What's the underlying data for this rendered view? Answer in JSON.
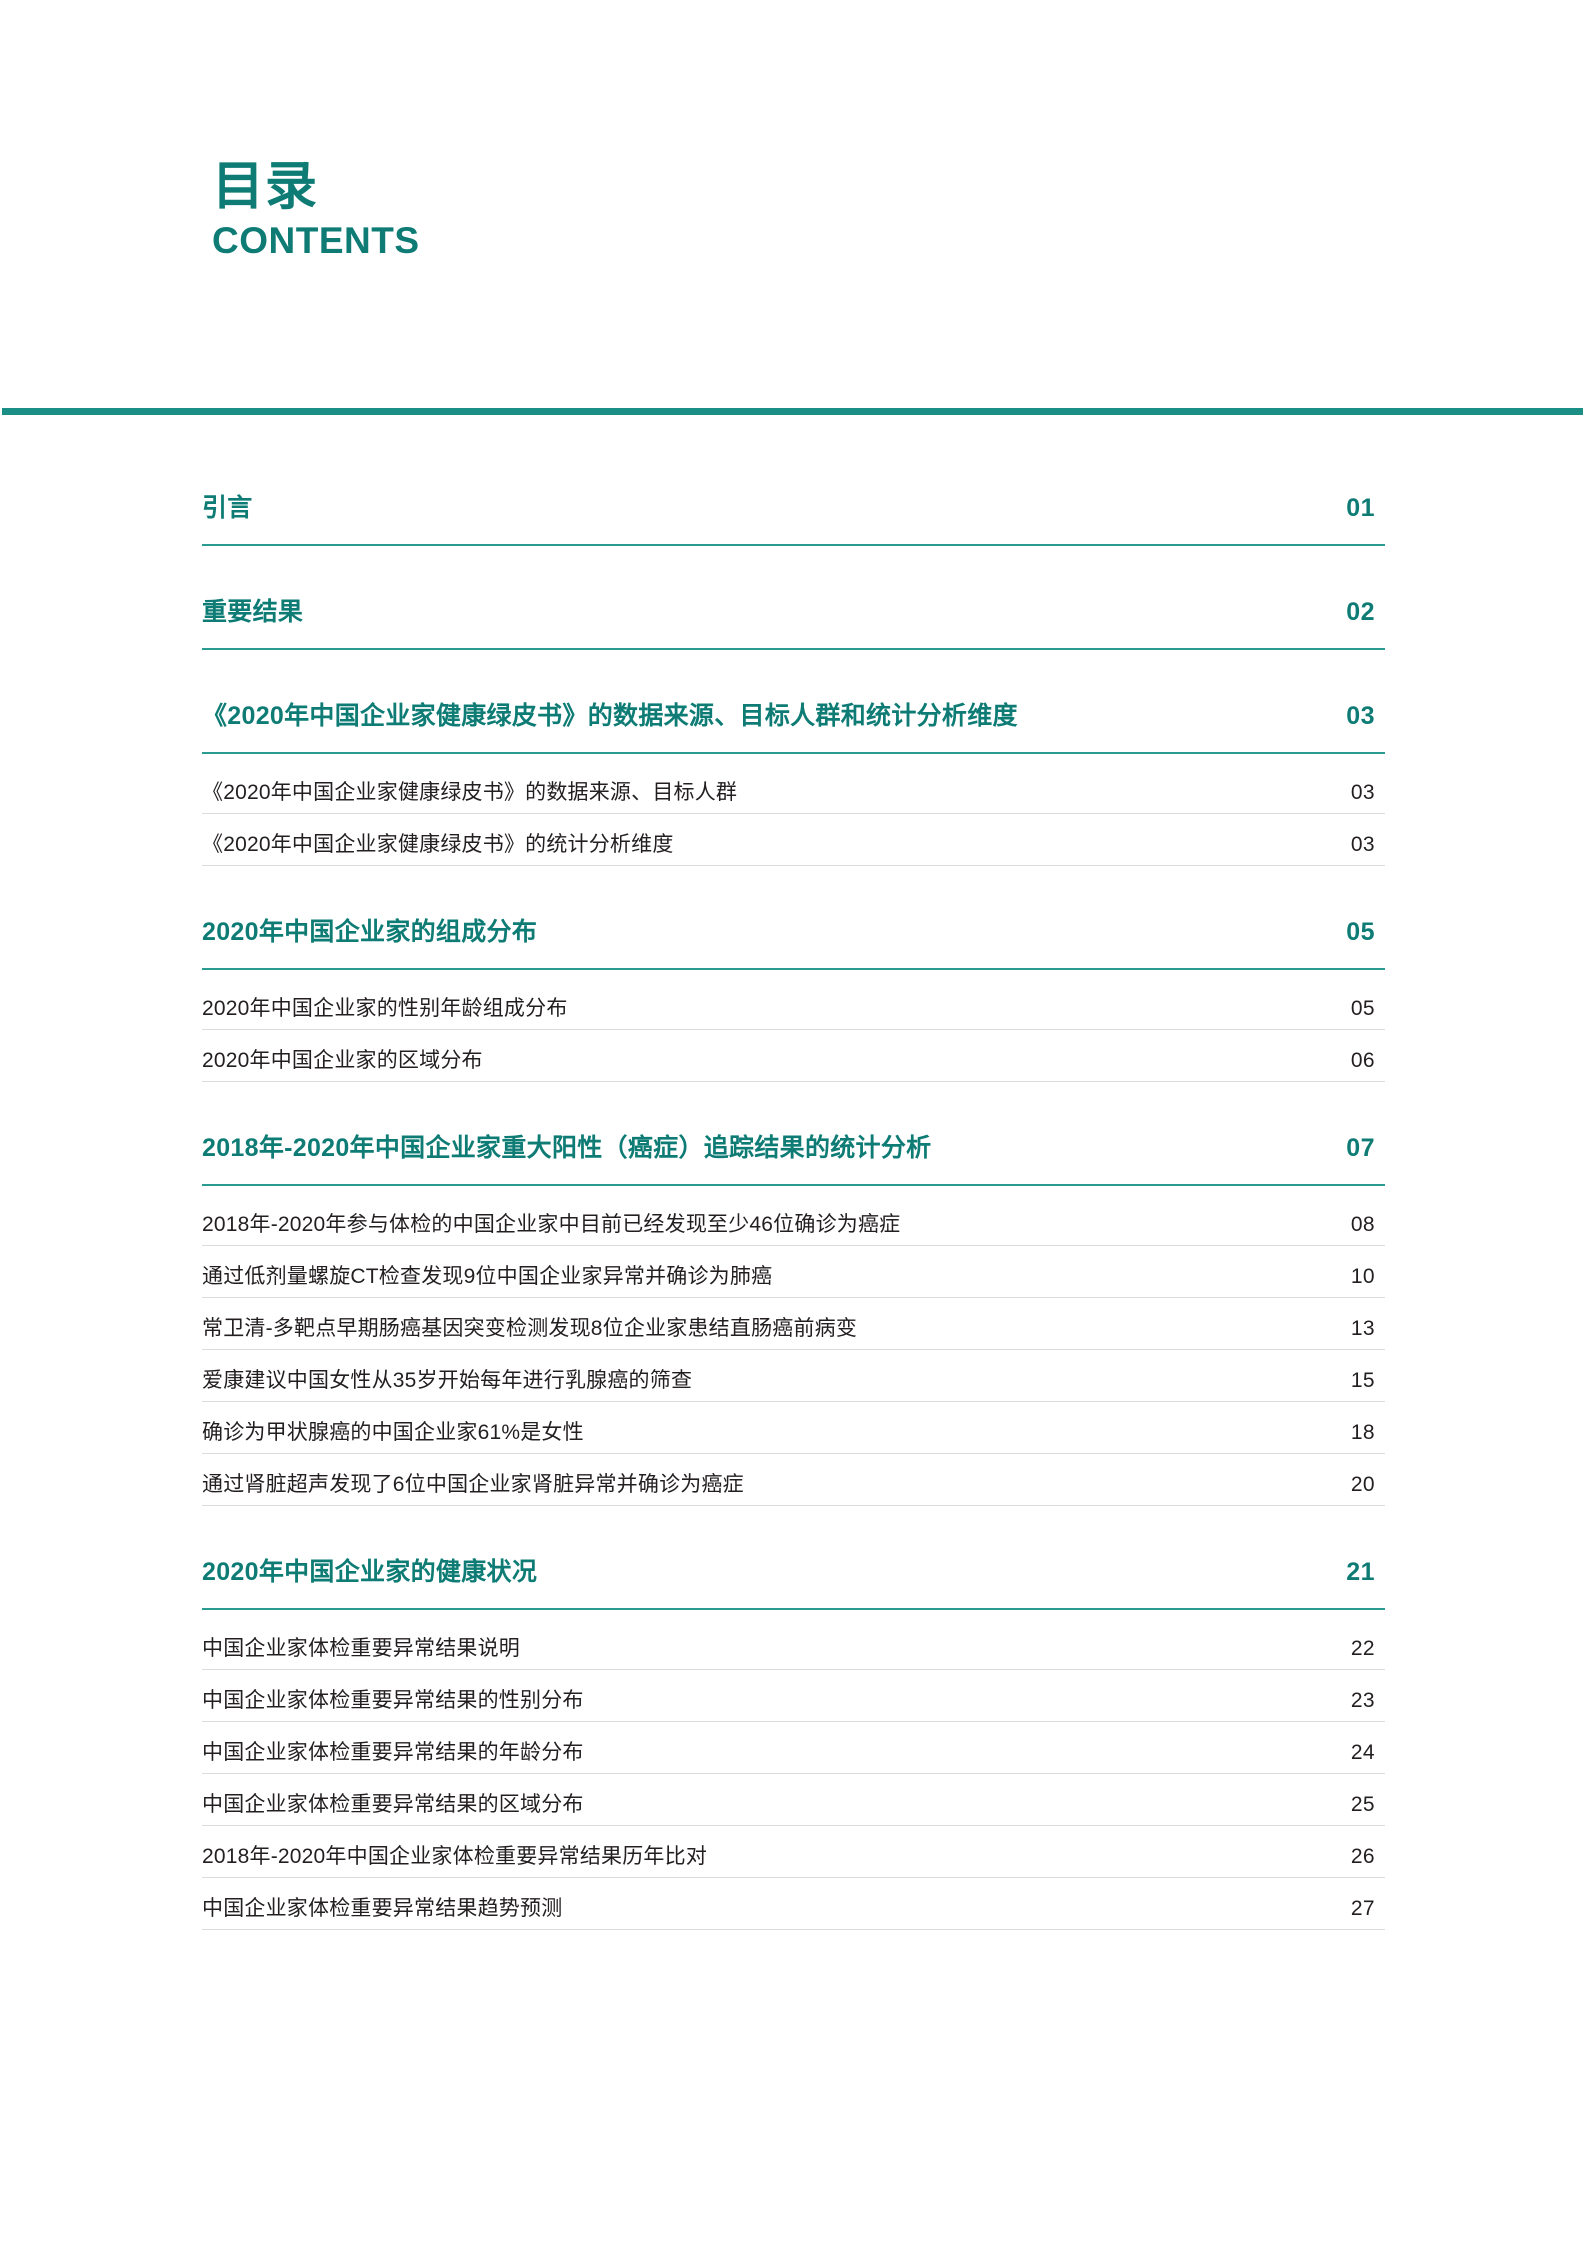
{
  "header": {
    "title_cn": "目录",
    "title_en": "CONTENTS"
  },
  "colors": {
    "accent_teal": "#0e7c75",
    "rule_teal": "#1b8e85",
    "sub_rule_gray": "#dcdcdc",
    "body_text": "#231f20"
  },
  "toc": {
    "groups": [
      {
        "section": {
          "label": "引言",
          "page": "01"
        },
        "subs": []
      },
      {
        "section": {
          "label": "重要结果",
          "page": "02"
        },
        "subs": []
      },
      {
        "section": {
          "label": "《2020年中国企业家健康绿皮书》的数据来源、目标人群和统计分析维度",
          "page": "03"
        },
        "subs": [
          {
            "label": "《2020年中国企业家健康绿皮书》的数据来源、目标人群",
            "page": "03"
          },
          {
            "label": "《2020年中国企业家健康绿皮书》的统计分析维度",
            "page": "03"
          }
        ]
      },
      {
        "section": {
          "label": "2020年中国企业家的组成分布",
          "page": "05"
        },
        "subs": [
          {
            "label": "2020年中国企业家的性别年龄组成分布",
            "page": "05"
          },
          {
            "label": "2020年中国企业家的区域分布",
            "page": "06"
          }
        ]
      },
      {
        "section": {
          "label": "2018年-2020年中国企业家重大阳性（癌症）追踪结果的统计分析",
          "page": "07"
        },
        "subs": [
          {
            "label": "2018年-2020年参与体检的中国企业家中目前已经发现至少46位确诊为癌症",
            "page": "08"
          },
          {
            "label": "通过低剂量螺旋CT检查发现9位中国企业家异常并确诊为肺癌",
            "page": "10"
          },
          {
            "label": "常卫清-多靶点早期肠癌基因突变检测发现8位企业家患结直肠癌前病变",
            "page": "13"
          },
          {
            "label": "爱康建议中国女性从35岁开始每年进行乳腺癌的筛查",
            "page": "15"
          },
          {
            "label": "确诊为甲状腺癌的中国企业家61%是女性",
            "page": "18"
          },
          {
            "label": "通过肾脏超声发现了6位中国企业家肾脏异常并确诊为癌症",
            "page": "20"
          }
        ]
      },
      {
        "section": {
          "label": "2020年中国企业家的健康状况",
          "page": "21"
        },
        "subs": [
          {
            "label": "中国企业家体检重要异常结果说明",
            "page": "22"
          },
          {
            "label": "中国企业家体检重要异常结果的性别分布",
            "page": "23"
          },
          {
            "label": "中国企业家体检重要异常结果的年龄分布",
            "page": "24"
          },
          {
            "label": "中国企业家体检重要异常结果的区域分布",
            "page": "25"
          },
          {
            "label": "2018年-2020年中国企业家体检重要异常结果历年比对",
            "page": "26"
          },
          {
            "label": "中国企业家体检重要异常结果趋势预测",
            "page": "27"
          }
        ]
      }
    ]
  }
}
